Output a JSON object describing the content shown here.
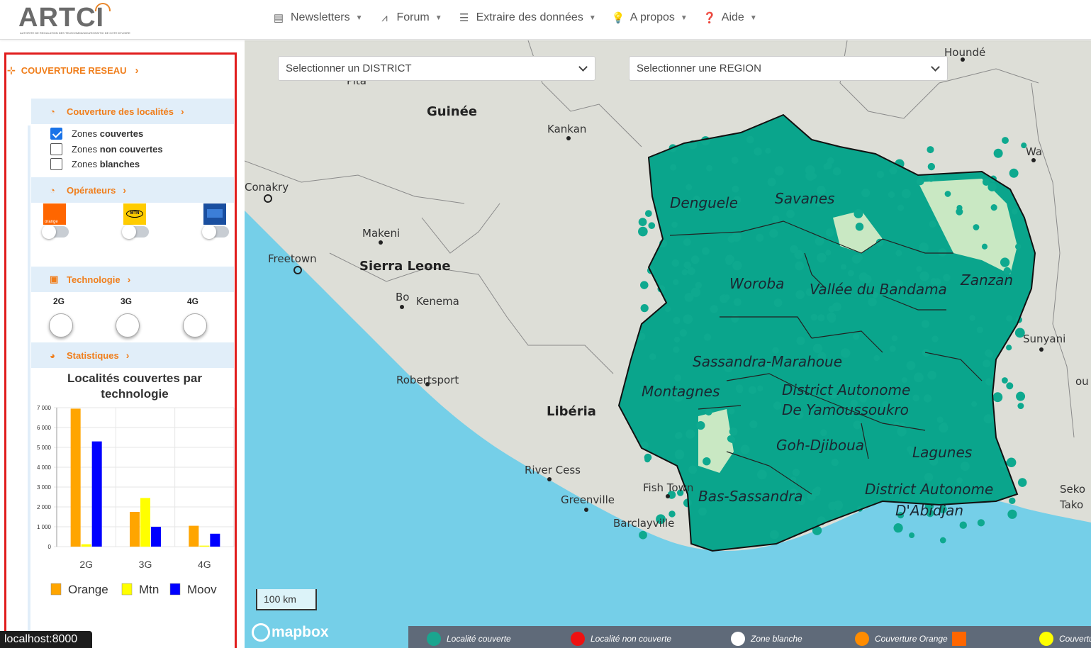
{
  "brand": {
    "name": "ARTCI",
    "tagline": "AUTORITE DE REGULATION DES TELECOMMUNICATIONS/TIC DE COTE D'IVOIRE"
  },
  "nav": [
    {
      "label": "Newsletters",
      "icon": "newspaper-icon"
    },
    {
      "label": "Forum",
      "icon": "rss-icon"
    },
    {
      "label": "Extraire des données",
      "icon": "database-icon"
    },
    {
      "label": "A propos",
      "icon": "lightbulb-icon"
    },
    {
      "label": "Aide",
      "icon": "question-circle-icon"
    }
  ],
  "sidebar": {
    "main_section": "COUVERTURE RESEAU",
    "coverage": {
      "title": "Couverture des localités",
      "options": [
        {
          "prefix": "Zones ",
          "bold": "couvertes",
          "checked": true
        },
        {
          "prefix": "Zones ",
          "bold": "non couvertes",
          "checked": false
        },
        {
          "prefix": "Zones ",
          "bold": "blanches",
          "checked": false
        }
      ]
    },
    "operators": {
      "title": "Opérateurs",
      "items": [
        {
          "name": "orange",
          "enabled": false
        },
        {
          "name": "MTN",
          "enabled": false
        },
        {
          "name": "moov",
          "enabled": false
        }
      ]
    },
    "technology": {
      "title": "Technologie",
      "items": [
        "2G",
        "3G",
        "4G"
      ]
    },
    "stats": {
      "title": "Statistiques"
    }
  },
  "chart_data": {
    "type": "bar",
    "title": "Localités couvertes par technologie",
    "categories": [
      "2G",
      "3G",
      "4G"
    ],
    "ylim": [
      0,
      7000
    ],
    "yticks": [
      "7 000",
      "6 000",
      "5 000",
      "4 000",
      "3 000",
      "2 000",
      "1 000",
      "0"
    ],
    "ytick_values": [
      7000,
      6000,
      5000,
      4000,
      3000,
      2000,
      1000,
      0
    ],
    "series": [
      {
        "name": "Orange",
        "color": "#ffa500",
        "values": [
          6950,
          1750,
          1050
        ]
      },
      {
        "name": "Mtn",
        "color": "#ffff00",
        "values": [
          120,
          2450,
          50
        ]
      },
      {
        "name": "Moov",
        "color": "#0000ff",
        "values": [
          5300,
          1000,
          650
        ]
      }
    ],
    "legend_position": "bottom"
  },
  "map": {
    "district_select": "Selectionner un DISTRICT",
    "region_select": "Selectionner une REGION",
    "scale": "100 km",
    "attribution": "mapbox",
    "country_labels": [
      "Guinée",
      "Sierra Leone",
      "Libéria"
    ],
    "city_labels": [
      "Houndé",
      "Pita",
      "Kankan",
      "Wa",
      "Conakry",
      "Makeni",
      "Freetown",
      "Bo",
      "Kenema",
      "Robertsport",
      "Sunyani",
      "River Cess",
      "Fish Town",
      "Greenville",
      "Barclayville",
      "Seko",
      "Tako",
      "ou"
    ],
    "region_labels": [
      "Denguele",
      "Savanes",
      "Woroba",
      "Vallée du Bandama",
      "Zanzan",
      "Sassandra-Marahoue",
      "Montagnes",
      "District Autonome",
      "De Yamoussoukro",
      "Goh-Djiboua",
      "Lagunes",
      "Bas-Sassandra",
      "District Autonome",
      "D'Abidjan"
    ],
    "legend": [
      {
        "label": "Localité couverte",
        "color": "#1aa58f"
      },
      {
        "label": "Localité non couverte",
        "color": "#ee1111"
      },
      {
        "label": "Zone blanche",
        "color": "#ffffff"
      },
      {
        "label": "Couverture Orange",
        "color": "#ff8c00"
      },
      {
        "label": "Couvertu",
        "color": "#ffff00"
      }
    ]
  },
  "status": {
    "url": "localhost:8000"
  }
}
